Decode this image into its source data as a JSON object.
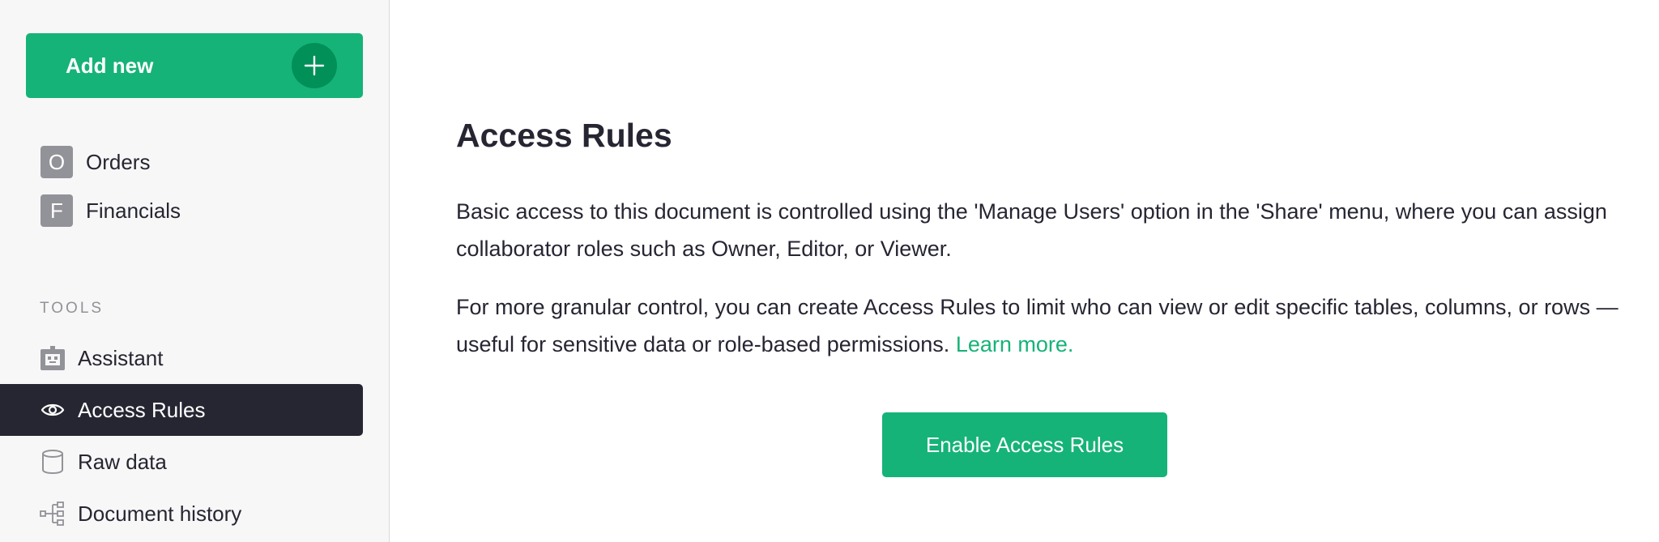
{
  "sidebar": {
    "add_new": {
      "label": "Add new",
      "icon": "plus-icon"
    },
    "pages": [
      {
        "initial": "O",
        "label": "Orders"
      },
      {
        "initial": "F",
        "label": "Financials"
      }
    ],
    "tools_heading": "TOOLS",
    "tools": [
      {
        "label": "Assistant",
        "icon": "robot-icon",
        "active": false
      },
      {
        "label": "Access Rules",
        "icon": "eye-icon",
        "active": true
      },
      {
        "label": "Raw data",
        "icon": "database-icon",
        "active": false
      },
      {
        "label": "Document history",
        "icon": "history-icon",
        "active": false
      }
    ]
  },
  "main": {
    "title": "Access Rules",
    "paragraph1": "Basic access to this document is controlled using the 'Manage Users' option in the 'Share' menu, where you can assign collaborator roles such as Owner, Editor, or Viewer.",
    "paragraph2": "For more granular control, you can create Access Rules to limit who can view or edit specific tables, columns, or rows — useful for sensitive data or role-based permissions.",
    "learn_more": "Learn more.",
    "enable_button": "Enable Access Rules"
  },
  "colors": {
    "accent": "#16b378",
    "accent_dark": "#009058",
    "active_bg": "#262633",
    "sidebar_bg": "#f7f7f7",
    "icon_gray": "#929299"
  }
}
